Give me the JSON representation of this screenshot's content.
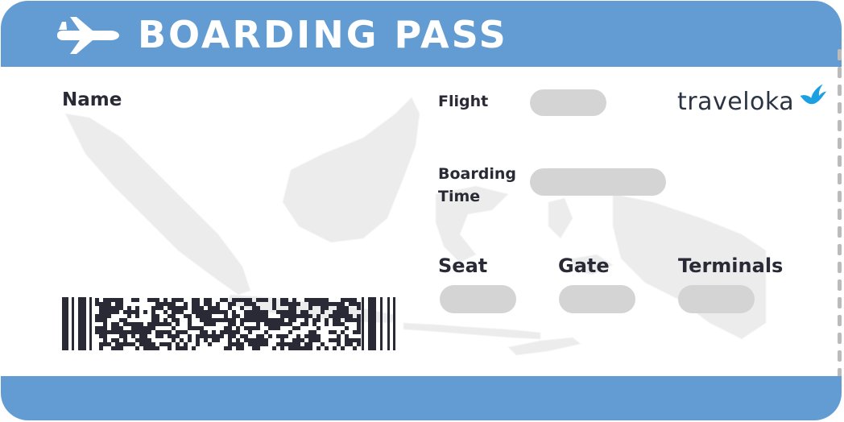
{
  "header": {
    "title": "BOARDING PASS",
    "icon": "airplane-icon"
  },
  "brand": {
    "logo_text": "traveloka",
    "icon": "bird-icon",
    "accent_color": "#1ba0e2"
  },
  "fields": {
    "name_label": "Name",
    "flight_label": "Flight",
    "boarding_time_line1": "Boarding",
    "boarding_time_line2": "Time",
    "seat_label": "Seat",
    "gate_label": "Gate",
    "terminals_label": "Terminals"
  },
  "colors": {
    "band": "#629cd2",
    "placeholder": "#d4d4d4",
    "label_text": "#2a2a36"
  }
}
